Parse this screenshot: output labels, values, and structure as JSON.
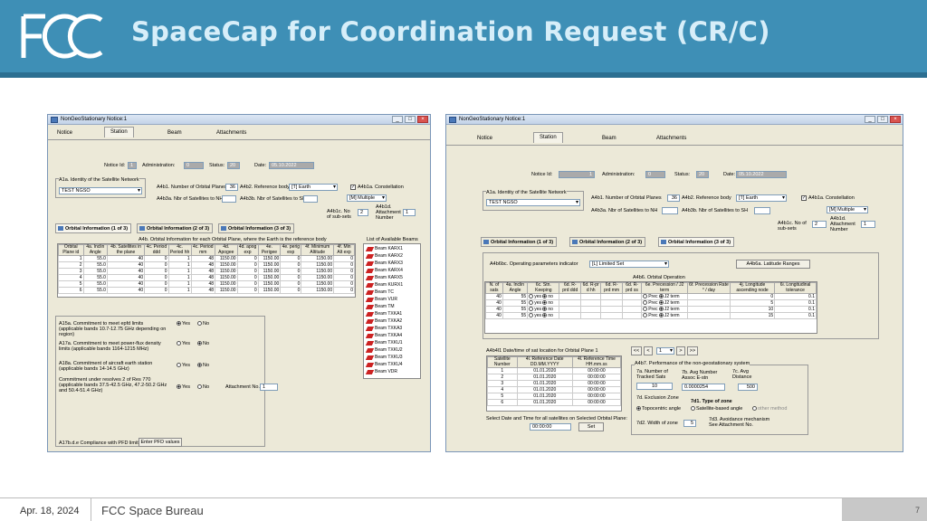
{
  "slide": {
    "title": "SpaceCap for Coordination Request (CR/C)",
    "date": "Apr. 18, 2024",
    "org": "FCC Space Bureau",
    "page_number": "7",
    "logo_text": "FCC"
  },
  "left_window": {
    "title": "NonGeoStationary Notice:1",
    "tabs": [
      "Notice",
      "Station",
      "Beam",
      "Attachments"
    ],
    "notice_id_label": "Notice Id:",
    "notice_id": "1",
    "admin_label": "Administration:",
    "admin": "0",
    "status_label": "Status:",
    "status": "20",
    "date_label": "Date:",
    "date": "05.10.2022",
    "sat_network_label": "A1a. Identity of the Satellite Network",
    "sat_network": "TEST NGSO",
    "orbital_planes_label": "A4b1. Number of Orbital Planes",
    "orbital_planes": "36",
    "ref_body_label": "A4b2. Reference body",
    "ref_body": "[T] Earth",
    "constellation_label": "A4b1a. Constellation",
    "constellation": "[M] Multiple",
    "sats_nh_label": "A4b3a. Nbr of Satellites to NH",
    "sats_sh_label": "A4b3b. Nbr of Satellites to SH",
    "subsets_label": "A4b1c. No of sub-sets",
    "subsets": "2",
    "attach_label": "A4b1d. Attachment Number",
    "attach": "1",
    "subtabs": [
      "Orbital Information (1 of 3)",
      "Orbital Information (2 of 3)",
      "Orbital Information (3 of 3)"
    ],
    "grid_caption": "A4b. Orbital Information for each Orbital Plane, where the Earth is the reference body",
    "columns": [
      "Orbital Plane id",
      "4a. Inclin Angle",
      "4b. Satellites in the plane",
      "4c. Period ddd",
      "4c. Period hh",
      "4c. Period mm",
      "4d. Apogee",
      "4d. apog exp",
      "4e. Perigee",
      "4e. perig exp",
      "4f. Minimum Altitude",
      "4f. Min Alt exp"
    ],
    "rows": [
      [
        "1",
        "55.0",
        "40",
        "0",
        "1",
        "48",
        "1150.00",
        "0",
        "1150.00",
        "0",
        "1150.00",
        "0"
      ],
      [
        "2",
        "55.0",
        "40",
        "0",
        "1",
        "48",
        "1150.00",
        "0",
        "1150.00",
        "0",
        "1150.00",
        "0"
      ],
      [
        "3",
        "55.0",
        "40",
        "0",
        "1",
        "48",
        "1150.00",
        "0",
        "1150.00",
        "0",
        "1150.00",
        "0"
      ],
      [
        "4",
        "55.0",
        "40",
        "0",
        "1",
        "48",
        "1150.00",
        "0",
        "1150.00",
        "0",
        "1150.00",
        "0"
      ],
      [
        "5",
        "55.0",
        "40",
        "0",
        "1",
        "48",
        "1150.00",
        "0",
        "1150.00",
        "0",
        "1150.00",
        "0"
      ],
      [
        "6",
        "55.0",
        "40",
        "0",
        "1",
        "48",
        "1150.00",
        "0",
        "1150.00",
        "0",
        "1150.00",
        "0"
      ]
    ],
    "beams_caption": "List of Available Beams",
    "beams": [
      "Beam KARX1",
      "Beam KARX2",
      "Beam KARX3",
      "Beam KARX4",
      "Beam KARX5",
      "Beam KURX1",
      "Beam TC",
      "Beam VUR",
      "Beam TM",
      "Beam TXKA1",
      "Beam TXKA2",
      "Beam TXKA3",
      "Beam TXKA4",
      "Beam TXKU1",
      "Beam TXKU2",
      "Beam TXKU3",
      "Beam TXKU4",
      "Beam VDR"
    ],
    "commitments": [
      {
        "text": "A15a. Commitment to meet epfd limits (applicable bands 10.7-12.75 GHz depending on region)",
        "yes": "Yes",
        "no": "No"
      },
      {
        "text": "A17a. Commitment to meet power-flux density limits (applicable bands 1164-1215 MHz)",
        "yes": "Yes",
        "no": "No"
      },
      {
        "text": "A18a. Commitment of aircraft earth station (applicable bands 14-14.5 GHz)",
        "yes": "Yes",
        "no": "No"
      },
      {
        "text": "Commitment under resolves 2 of Res 770 (applicable bands 37.5-42.5 GHz, 47.2-50.2 GHz and 50.4-51.4 GHz)",
        "yes": "Yes",
        "no": "No"
      }
    ],
    "attachment_no_label": "Attachment No.",
    "attachment_no": "1",
    "pfd_label": "A17b.d.e Compliance with PFD limits",
    "pfd_button": "Enter PFD values"
  },
  "right_window": {
    "title": "NonGeoStationary Notice:1",
    "tabs": [
      "Notice",
      "Station",
      "Beam",
      "Attachments"
    ],
    "notice_id_label": "Notice Id:",
    "notice_id": "1",
    "admin_label": "Administration:",
    "admin": "0",
    "status_label": "Status:",
    "status": "20",
    "date_label": "Date:",
    "date": "05.10.2022",
    "sat_network_label": "A1a. Identity of the Satellite Network",
    "sat_network": "TEST NGSO",
    "orbital_planes_label": "A4b1. Number of Orbital Planes",
    "orbital_planes": "36",
    "ref_body_label": "A4b2. Reference body",
    "ref_body": "[T] Earth",
    "constellation_label": "A4b1a. Constellation",
    "constellation": "[M] Multiple",
    "sats_nh_label": "A4b3a. Nbr of Satellites to NH",
    "sats_sh_label": "A4b3b. Nbr of Satellites to SH",
    "subsets_label": "A4b1c. No of sub-sets",
    "subsets": "2",
    "attach_label": "A4b1d. Attachment Number",
    "attach": "1",
    "subtabs": [
      "Orbital Information (1 of 3)",
      "Orbital Information (2 of 3)",
      "Orbital Information (3 of 3)"
    ],
    "op_indicator_label": "A4b6bc. Operating parameters indicator",
    "op_indicator": "[L] Limited Set",
    "latitude_button": "A4b6a. Latitude Ranges",
    "orbital_op_caption": "A4b6. Orbital Operation",
    "op_columns": [
      "N. of sats",
      "4a. Inclin Angle",
      "6c. Stn. Keeping",
      "6d. R-prd ddd",
      "6d. R-pr d hh",
      "6d. R-prd mm",
      "6d. R-prd ss",
      "6e. Precession / J2 term",
      "6f. Precession Rate ° / day",
      "4j. Longitude ascending node",
      "6i. Longitudinal tolerance"
    ],
    "op_rows": [
      {
        "n": "40",
        "incl": "55",
        "asc": "0",
        "tol": "0.1"
      },
      {
        "n": "40",
        "incl": "55",
        "asc": "5",
        "tol": "0.1"
      },
      {
        "n": "40",
        "incl": "55",
        "asc": "10",
        "tol": "0.1"
      },
      {
        "n": "40",
        "incl": "55",
        "asc": "15",
        "tol": "0.1"
      }
    ],
    "opt_yes": "yes",
    "opt_no": "no",
    "opt_prec": "Prec",
    "opt_j2": "J2 term",
    "datetime_caption": "A4b4l1 Date/time of sat location for Orbital Plane 1",
    "dt_columns": [
      "Satellite Number",
      "4l. Reference Date DD.MM.YYYY",
      "4l. Reference Time HH.mm.ss"
    ],
    "dt_rows": [
      [
        "1",
        "01.01.2020",
        "00:00:00"
      ],
      [
        "2",
        "01.01.2020",
        "00:00:00"
      ],
      [
        "3",
        "01.01.2020",
        "00:00:00"
      ],
      [
        "4",
        "01.01.2020",
        "00:00:00"
      ],
      [
        "5",
        "01.01.2020",
        "00:00:00"
      ],
      [
        "6",
        "01.01.2020",
        "00:00:00"
      ]
    ],
    "pager": {
      "first": "<<",
      "prev": "<",
      "page": "1",
      "next": ">",
      "last": ">>"
    },
    "select_datetime_label": "Select Date and Time for all satellites on Selected Orbital Plane:",
    "select_time": "00:00:00",
    "set_button": "Set",
    "perf_caption": "A4b7. Performance of the non-geostationary system",
    "tracked_label": "7a. Number of Tracked Sats",
    "tracked": "10",
    "avg_label": "7b. Avg Number Assoc E-stn",
    "avg": "0.0000254",
    "dist_label": "7c. Avg Distance",
    "dist": "500",
    "exclusion_label": "7d. Exclusion Zone",
    "zone_type_label": "7d1. Type of zone",
    "zone_opts": [
      "Topocentric angle",
      "Satellite-based angle",
      "other method"
    ],
    "width_label": "7d2. Width of zone",
    "width": "5",
    "avoid_label": "7d3. Avoidance mechanism See Attachment No."
  }
}
